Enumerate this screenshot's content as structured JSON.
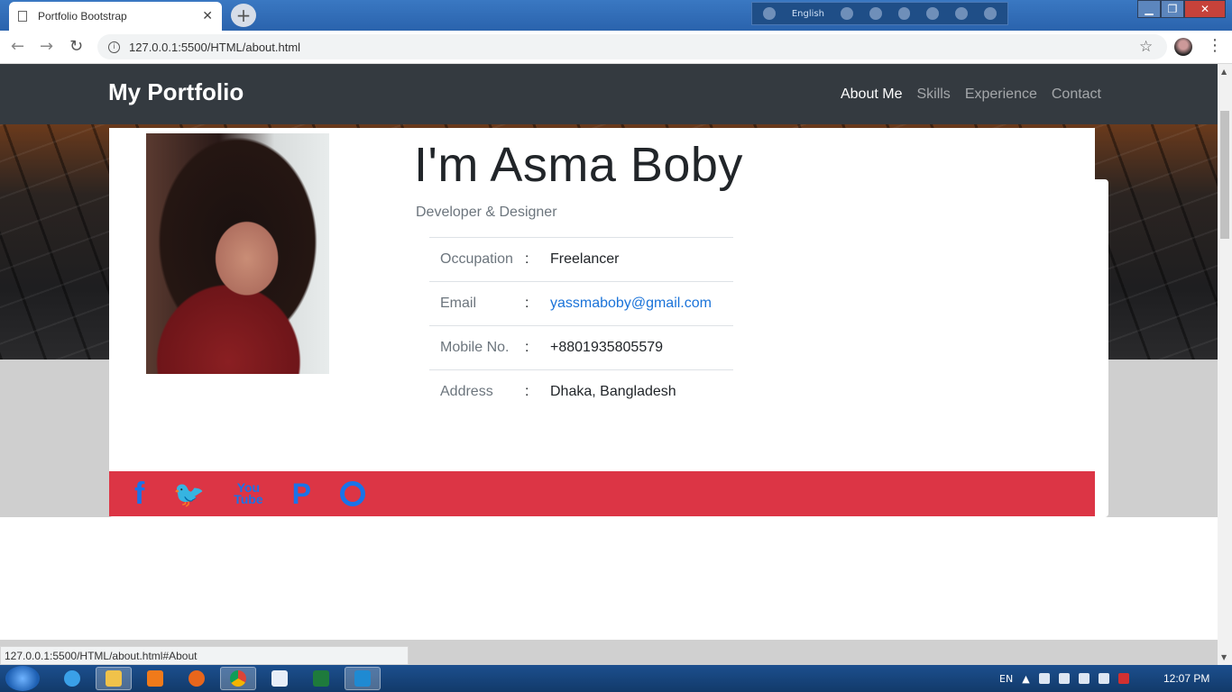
{
  "browser": {
    "tab_title": "Portfolio Bootstrap",
    "tab_close": "✕",
    "new_tab": "+",
    "url": "127.0.0.1:5500/HTML/about.html",
    "status_url": "127.0.0.1:5500/HTML/about.html#About",
    "language": "English"
  },
  "site": {
    "brand": "My Portfolio",
    "nav": [
      {
        "label": "About Me",
        "active": true
      },
      {
        "label": "Skills",
        "active": false
      },
      {
        "label": "Experience",
        "active": false
      },
      {
        "label": "Contact",
        "active": false
      }
    ]
  },
  "profile": {
    "heading": "I'm Asma Boby",
    "subheading": "Developer & Designer",
    "separator": ":",
    "rows": [
      {
        "label": "Occupation",
        "value": "Freelancer"
      },
      {
        "label": "Email",
        "value": "yassmaboby@gmail.com"
      },
      {
        "label": "Mobile No.",
        "value": "+8801935805579"
      },
      {
        "label": "Address",
        "value": "Dhaka, Bangladesh"
      }
    ]
  },
  "social": {
    "icons": [
      "facebook-icon",
      "twitter-icon",
      "youtube-icon",
      "pinterest-icon",
      "github-icon"
    ],
    "facebook_glyph": "f",
    "twitter_glyph": "🐦",
    "youtube_glyph_top": "You",
    "youtube_glyph_bottom": "Tube",
    "pinterest_glyph": "P",
    "color": "#1a73e8",
    "bar_color": "#dc3545"
  },
  "taskbar": {
    "lang": "EN",
    "time": "12:07 PM"
  }
}
